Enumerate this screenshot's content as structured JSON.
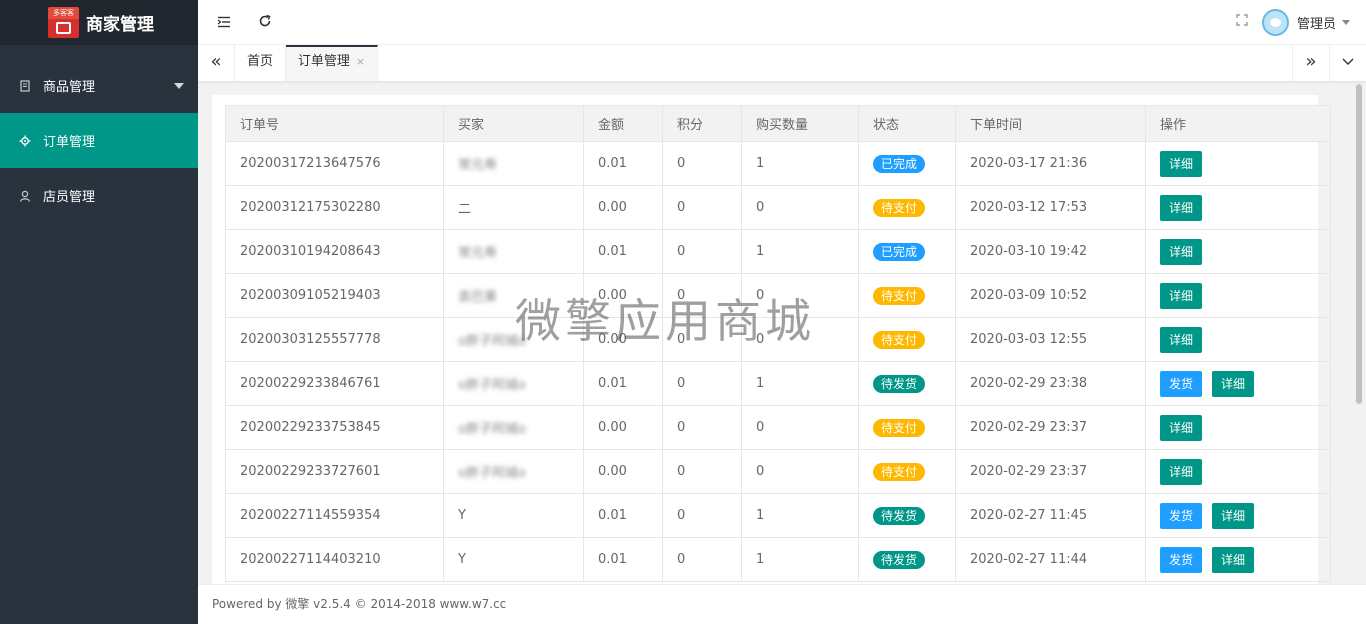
{
  "sidebar": {
    "logo_badge": "多客客",
    "title": "商家管理",
    "items": [
      {
        "label": "商品管理",
        "icon": "document-icon"
      },
      {
        "label": "订单管理",
        "icon": "gear-icon"
      },
      {
        "label": "店员管理",
        "icon": "user-icon"
      }
    ]
  },
  "header": {
    "user_name": "管理员"
  },
  "tabs": {
    "home": "首页",
    "current": "订单管理",
    "close": "×"
  },
  "table": {
    "columns": [
      "订单号",
      "买家",
      "金额",
      "积分",
      "购买数量",
      "状态",
      "下单时间",
      "操作"
    ],
    "rows": [
      {
        "id": "20200317213647576",
        "buyer": "常元寿",
        "amount": "0.01",
        "points": "0",
        "qty": "1",
        "status": "已完成",
        "time": "2020-03-17 21:36"
      },
      {
        "id": "20200312175302280",
        "buyer": "二",
        "amount": "0.00",
        "points": "0",
        "qty": "0",
        "status": "待支付",
        "time": "2020-03-12 17:53"
      },
      {
        "id": "20200310194208643",
        "buyer": "常元寿",
        "amount": "0.01",
        "points": "0",
        "qty": "1",
        "status": "已完成",
        "time": "2020-03-10 19:42"
      },
      {
        "id": "20200309105219403",
        "buyer": "袁巴果",
        "amount": "0.00",
        "points": "0",
        "qty": "0",
        "status": "待支付",
        "time": "2020-03-09 10:52"
      },
      {
        "id": "20200303125557778",
        "buyer": "o胖子阿城o",
        "amount": "0.00",
        "points": "0",
        "qty": "0",
        "status": "待支付",
        "time": "2020-03-03 12:55"
      },
      {
        "id": "20200229233846761",
        "buyer": "o胖子阿城o",
        "amount": "0.01",
        "points": "0",
        "qty": "1",
        "status": "待发货",
        "time": "2020-02-29 23:38"
      },
      {
        "id": "20200229233753845",
        "buyer": "o胖子阿城o",
        "amount": "0.00",
        "points": "0",
        "qty": "0",
        "status": "待支付",
        "time": "2020-02-29 23:37"
      },
      {
        "id": "20200229233727601",
        "buyer": "o胖子阿城o",
        "amount": "0.00",
        "points": "0",
        "qty": "0",
        "status": "待支付",
        "time": "2020-02-29 23:37"
      },
      {
        "id": "20200227114559354",
        "buyer": "Y",
        "amount": "0.01",
        "points": "0",
        "qty": "1",
        "status": "待发货",
        "time": "2020-02-27 11:45"
      },
      {
        "id": "20200227114403210",
        "buyer": "Y",
        "amount": "0.01",
        "points": "0",
        "qty": "1",
        "status": "待发货",
        "time": "2020-02-27 11:44"
      }
    ],
    "detail_label": "详细",
    "ship_label": "发货"
  },
  "status_colors": {
    "已完成": "#1e9fff",
    "待支付": "#ffb800",
    "待发货": "#009688"
  },
  "watermark": "微擎应用商城",
  "footer": "Powered by 微擎 v2.5.4 © 2014-2018 www.w7.cc"
}
